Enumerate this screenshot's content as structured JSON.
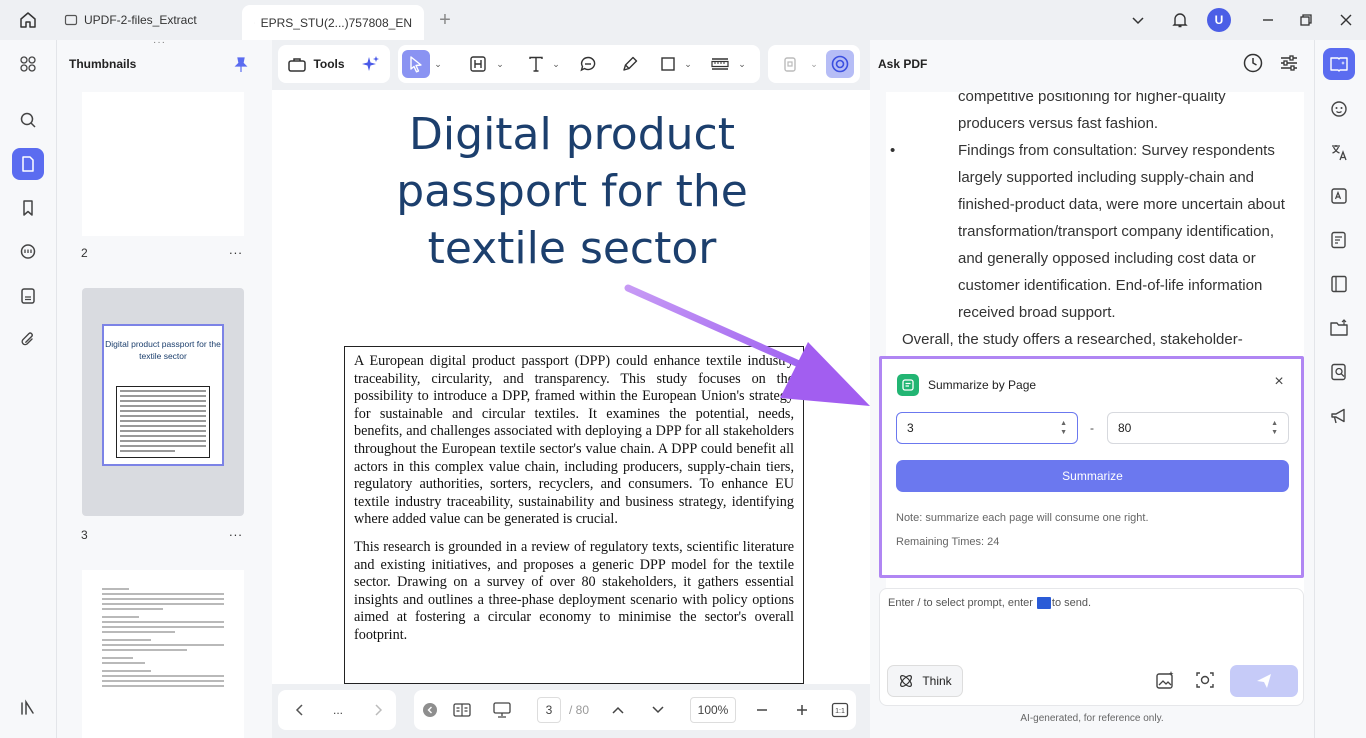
{
  "tabs": [
    {
      "label": "UPDF-2-files_Extract"
    },
    {
      "label": "EPRS_STU(2...)757808_EN"
    }
  ],
  "user": {
    "avatar_letter": "U"
  },
  "thumbnails": {
    "title": "Thumbnails",
    "pages": [
      {
        "number": "2",
        "more": "..."
      },
      {
        "number": "3",
        "more": "..."
      }
    ],
    "selected_mini_title": "Digital product passport for the textile sector"
  },
  "toolbar": {
    "tools_label": "Tools"
  },
  "document": {
    "title": "Digital product passport for the textile sector",
    "abstract_p1": "A European digital product passport (DPP) could enhance textile industry traceability, circularity, and transparency. This study focuses on the possibility to introduce a DPP, framed within the European Union's strategy for sustainable and circular textiles. It examines the potential, needs, benefits, and challenges associated with deploying a DPP for all stakeholders throughout the European textile sector's value chain. A DPP could benefit all actors in this complex value chain, including producers, supply-chain tiers, regulatory authorities, sorters, recyclers, and consumers. To enhance EU textile industry traceability, sustainability and business strategy, identifying where added value can be generated is crucial.",
    "abstract_p2": "This research is grounded in a review of regulatory texts, scientific literature and existing initiatives, and proposes a generic DPP model for the textile sector. Drawing on a survey of over 80 stakeholders, it gathers essential insights and outlines a three-phase deployment scenario with policy options aimed at fostering a circular economy to minimise the sector's overall footprint."
  },
  "pager": {
    "more": "...",
    "current_page": "3",
    "total_pages": "/ 80",
    "zoom": "100%"
  },
  "ask_pdf": {
    "title": "Ask PDF",
    "chat_lines": [
      "competitive positioning for higher-quality",
      "producers versus fast fashion.",
      "Findings from consultation: Survey respondents",
      "largely supported including supply-chain and",
      "finished-product data, were more uncertain about",
      "transformation/transport company identification,",
      "and generally opposed including cost data or",
      "customer identification. End-of-life information",
      "received broad support.",
      "Overall, the study offers a researched, stakeholder-"
    ],
    "summarize": {
      "title": "Summarize by Page",
      "close": "×",
      "from_page": "3",
      "dash": "-",
      "to_page": "80",
      "button": "Summarize",
      "note": "Note: summarize each page will consume one right.",
      "remaining": "Remaining Times: 24"
    },
    "prompt_placeholder_a": "Enter / to select prompt, enter",
    "prompt_placeholder_b": "to send.",
    "think_label": "Think",
    "ai_note": "AI-generated, for reference only."
  },
  "colors": {
    "accent": "#5b6cf0",
    "highlight_border": "#b086f3",
    "title_blue": "#1c3f6d",
    "arrow": "#a66cf0"
  }
}
